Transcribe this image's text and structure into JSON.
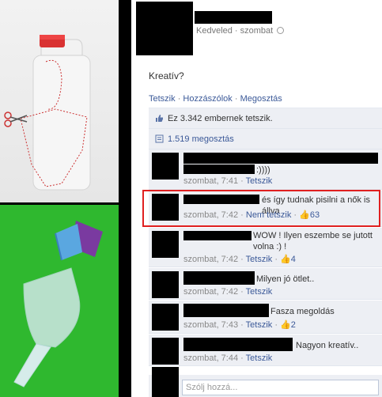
{
  "post": {
    "meta": "Kedveled · szombat",
    "text": "Kreatív?",
    "actions": {
      "like": "Tetszik",
      "comment": "Hozzászólok",
      "share": "Megosztás"
    }
  },
  "ufi": {
    "likes": "Ez 3.342 embernek tetszik.",
    "shares": "1.519 megosztás"
  },
  "comments": [
    {
      "text": ":))))",
      "time": "szombat, 7:41",
      "like_label": "Tetszik",
      "likes": ""
    },
    {
      "text": "és így tudnak pisilni a nők is állva",
      "time": "szombat, 7:42",
      "like_label": "Nem tetszik",
      "likes": "63"
    },
    {
      "text": "WOW ! Ilyen eszembe se jutott volna :) !",
      "time": "szombat, 7:42",
      "like_label": "Tetszik",
      "likes": "4"
    },
    {
      "text": "Milyen jó ötlet..",
      "time": "szombat, 7:42",
      "like_label": "Tetszik",
      "likes": ""
    },
    {
      "text": "Fasza megoldás",
      "time": "szombat, 7:43",
      "like_label": "Tetszik",
      "likes": "2"
    },
    {
      "text": "Nagyon kreatív..",
      "time": "szombat, 7:44",
      "like_label": "Tetszik",
      "likes": ""
    }
  ],
  "write": {
    "placeholder": "Szólj hozzá..."
  },
  "colors": {
    "link": "#3b5998",
    "ufi_bg": "#edeff4",
    "highlight": "#e02020"
  },
  "icons": [
    "globe-icon",
    "like-thumb-icon",
    "share-icon",
    "scissors-icon"
  ]
}
